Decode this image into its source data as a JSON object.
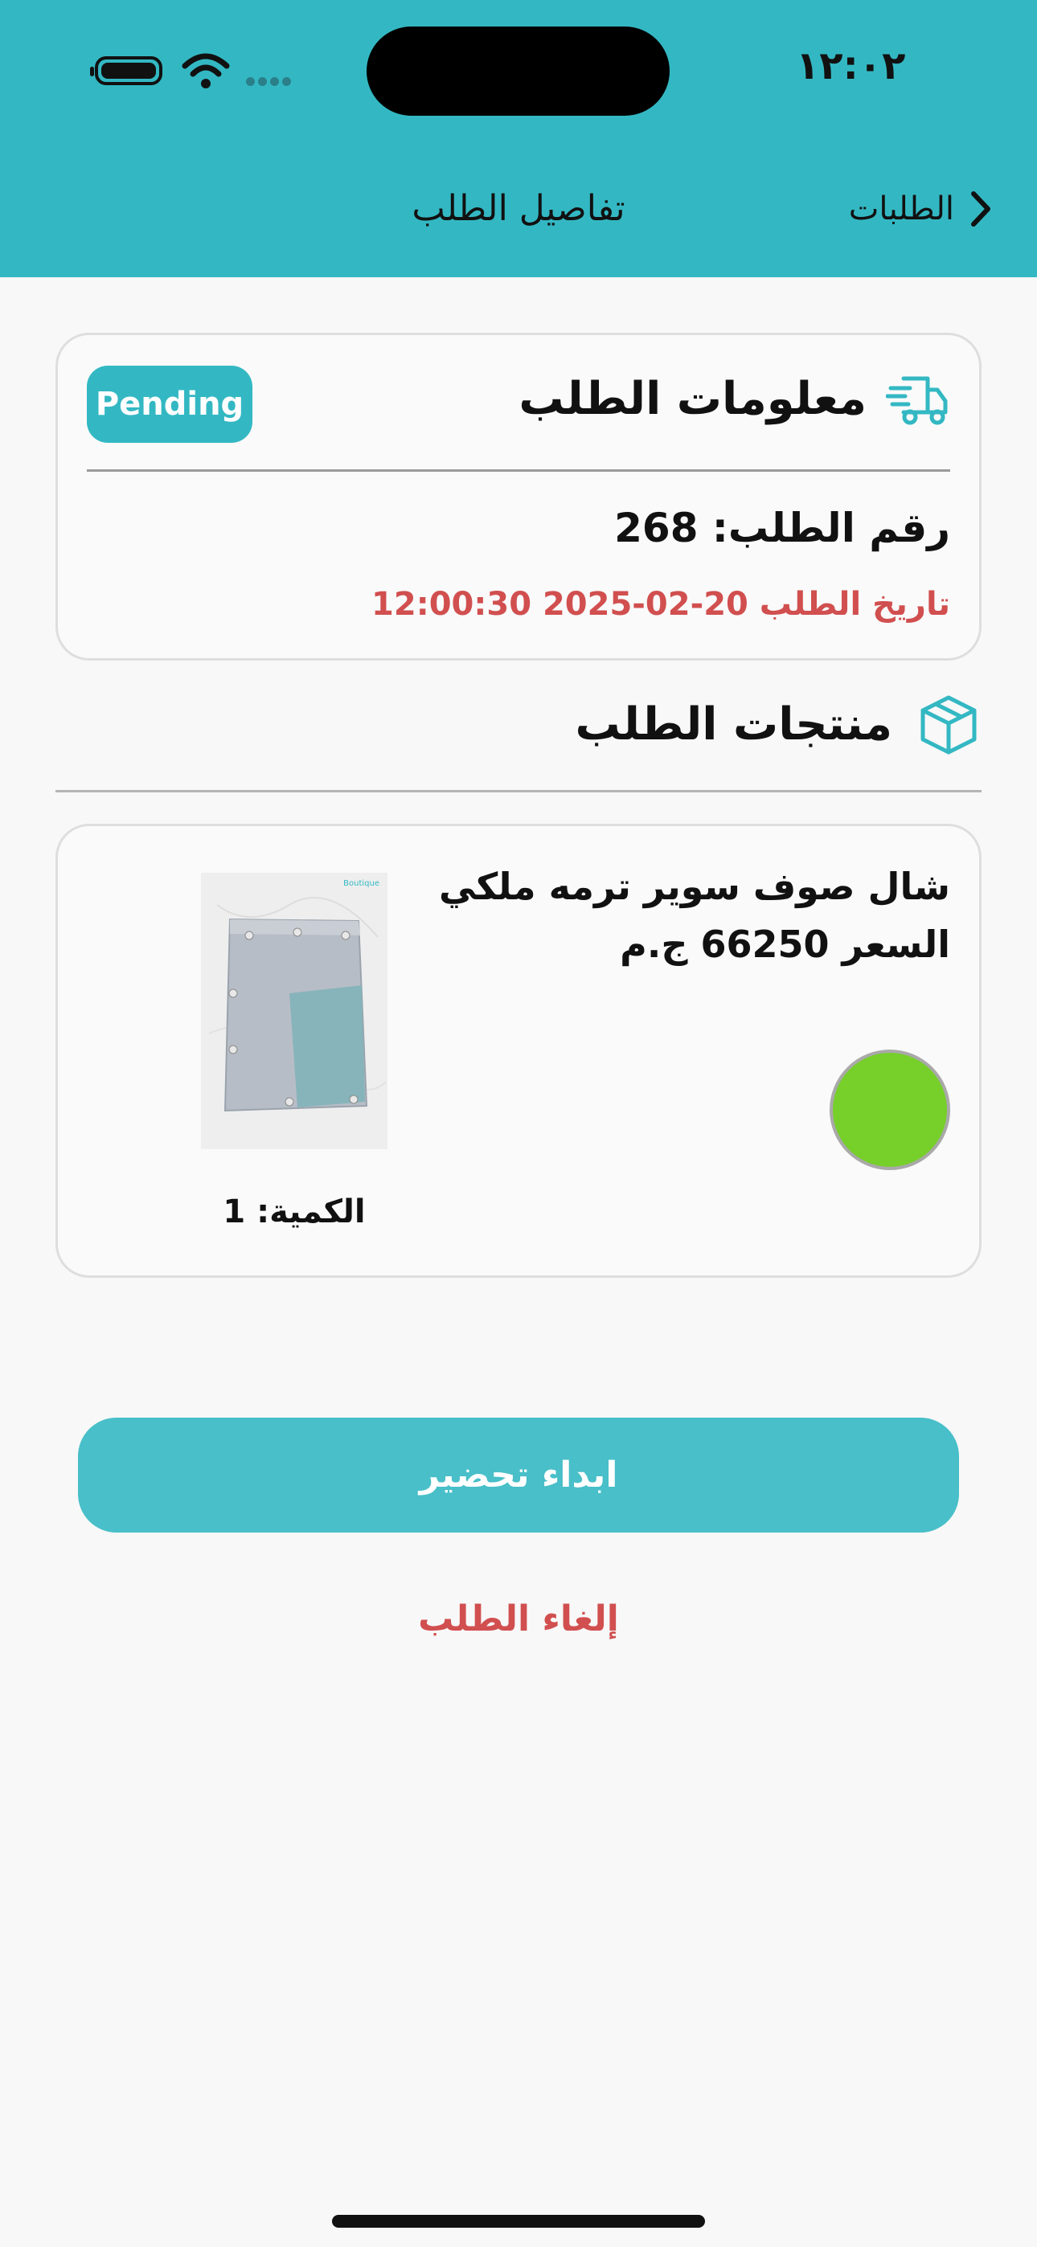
{
  "status_bar": {
    "time": "١٢:٠٢"
  },
  "nav": {
    "title": "تفاصيل الطلب",
    "back_label": "الطلبات"
  },
  "order_info": {
    "section_title": "معلومات الطلب",
    "status_badge": "Pending",
    "order_number": "رقم الطلب: 268",
    "order_date": "تاريخ الطلب 20-02-2025 12:00:30"
  },
  "products_section": {
    "title": "منتجات الطلب",
    "items": [
      {
        "name": "شال صوف سوير ترمه ملكي",
        "price": "السعر 66250 ج.م",
        "quantity": "الكمية: 1",
        "image_brand": "Boutique",
        "color": "#77cf2a"
      }
    ]
  },
  "actions": {
    "start_preparing": "ابداء تحضير",
    "cancel_order": "إلغاء الطلب"
  },
  "colors": {
    "primary": "#33b8c3",
    "danger": "#d14f4f"
  },
  "icons": {
    "back": "chevron-left-icon",
    "order_info": "delivery-truck-icon",
    "products": "package-box-icon"
  }
}
